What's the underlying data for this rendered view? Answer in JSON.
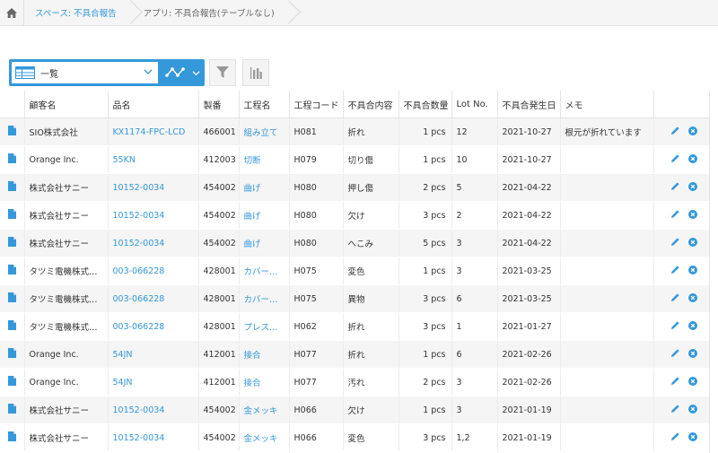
{
  "breadcrumb": {
    "space": "スペース: 不具合報告",
    "app": "アプリ: 不具合報告(テーブルなし)"
  },
  "toolbar": {
    "view_name": "一覧"
  },
  "colors": {
    "accent": "#3498db"
  },
  "table": {
    "headers": [
      "顧客名",
      "品名",
      "製番",
      "工程名",
      "工程コード",
      "不具合内容",
      "不具合数量",
      "Lot No.",
      "不具合発生日",
      "メモ"
    ],
    "rows": [
      {
        "customer": "SIO株式会社",
        "product": "KX1174-FPC-LCD",
        "serial": "466001",
        "process": "組み立て",
        "code": "H081",
        "defect": "折れ",
        "qty": "1 pcs",
        "lot": "12",
        "date": "2021-10-27",
        "memo": "根元が折れています"
      },
      {
        "customer": "Orange Inc.",
        "product": "55KN",
        "serial": "412003",
        "process": "切断",
        "code": "H079",
        "defect": "切り傷",
        "qty": "1 pcs",
        "lot": "10",
        "date": "2021-10-27",
        "memo": ""
      },
      {
        "customer": "株式会社サニー",
        "product": "10152-0034",
        "serial": "454002",
        "process": "曲げ",
        "code": "H080",
        "defect": "押し傷",
        "qty": "2 pcs",
        "lot": "5",
        "date": "2021-04-22",
        "memo": ""
      },
      {
        "customer": "株式会社サニー",
        "product": "10152-0034",
        "serial": "454002",
        "process": "曲げ",
        "code": "H080",
        "defect": "欠け",
        "qty": "3 pcs",
        "lot": "2",
        "date": "2021-04-22",
        "memo": ""
      },
      {
        "customer": "株式会社サニー",
        "product": "10152-0034",
        "serial": "454002",
        "process": "曲げ",
        "code": "H080",
        "defect": "へこみ",
        "qty": "5 pcs",
        "lot": "3",
        "date": "2021-04-22",
        "memo": ""
      },
      {
        "customer": "タツミ電機株式…",
        "product": "003-066228",
        "serial": "428001",
        "process": "カバー…",
        "code": "H075",
        "defect": "変色",
        "qty": "1 pcs",
        "lot": "3",
        "date": "2021-03-25",
        "memo": ""
      },
      {
        "customer": "タツミ電機株式…",
        "product": "003-066228",
        "serial": "428001",
        "process": "カバー…",
        "code": "H075",
        "defect": "異物",
        "qty": "3 pcs",
        "lot": "6",
        "date": "2021-03-25",
        "memo": ""
      },
      {
        "customer": "タツミ電機株式…",
        "product": "003-066228",
        "serial": "428001",
        "process": "プレス…",
        "code": "H062",
        "defect": "折れ",
        "qty": "3 pcs",
        "lot": "1",
        "date": "2021-01-27",
        "memo": ""
      },
      {
        "customer": "Orange Inc.",
        "product": "54JN",
        "serial": "412001",
        "process": "接合",
        "code": "H077",
        "defect": "折れ",
        "qty": "1 pcs",
        "lot": "6",
        "date": "2021-02-26",
        "memo": ""
      },
      {
        "customer": "Orange Inc.",
        "product": "54JN",
        "serial": "412001",
        "process": "接合",
        "code": "H077",
        "defect": "汚れ",
        "qty": "2 pcs",
        "lot": "3",
        "date": "2021-02-26",
        "memo": ""
      },
      {
        "customer": "株式会社サニー",
        "product": "10152-0034",
        "serial": "454002",
        "process": "金メッキ",
        "code": "H066",
        "defect": "欠け",
        "qty": "1 pcs",
        "lot": "3",
        "date": "2021-01-19",
        "memo": ""
      },
      {
        "customer": "株式会社サニー",
        "product": "10152-0034",
        "serial": "454002",
        "process": "金メッキ",
        "code": "H066",
        "defect": "変色",
        "qty": "3 pcs",
        "lot": "1,2",
        "date": "2021-01-19",
        "memo": ""
      }
    ]
  }
}
